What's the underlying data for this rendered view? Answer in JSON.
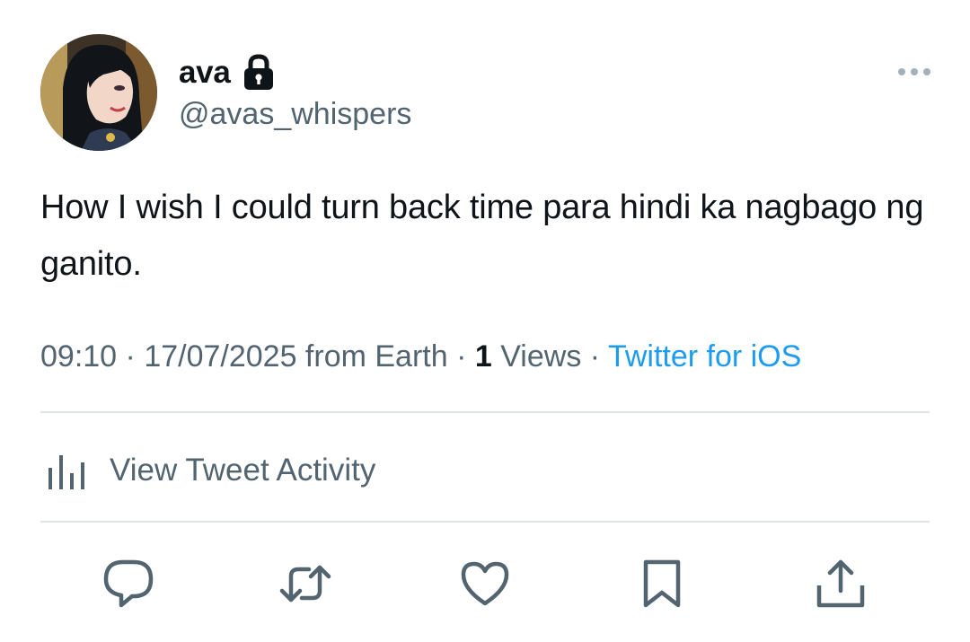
{
  "author": {
    "display_name": "ava",
    "handle": "@avas_whispers",
    "protected_icon": "lock-icon",
    "avatar_icon": "cartoon-woman-avatar"
  },
  "tweet": {
    "text": "How I wish I could turn back time para hindi ka nagbago ng ganito."
  },
  "meta": {
    "time": "09:10",
    "sep1": " · ",
    "date": "17/07/2025",
    "location": " from Earth",
    "sep2": " · ",
    "views_count": "1",
    "views_label": " Views",
    "sep3": " · ",
    "source": "Twitter for iOS"
  },
  "activity": {
    "label": "View Tweet Activity",
    "icon": "bar-chart-icon"
  },
  "actions": {
    "reply_icon": "reply-icon",
    "retweet_icon": "retweet-icon",
    "like_icon": "heart-icon",
    "bookmark_icon": "bookmark-icon",
    "share_icon": "share-icon"
  },
  "colors": {
    "text_primary": "#0f1419",
    "text_secondary": "#536471",
    "link_blue": "#1d9bf0",
    "divider": "#dde3e8",
    "background": "#ffffff"
  }
}
